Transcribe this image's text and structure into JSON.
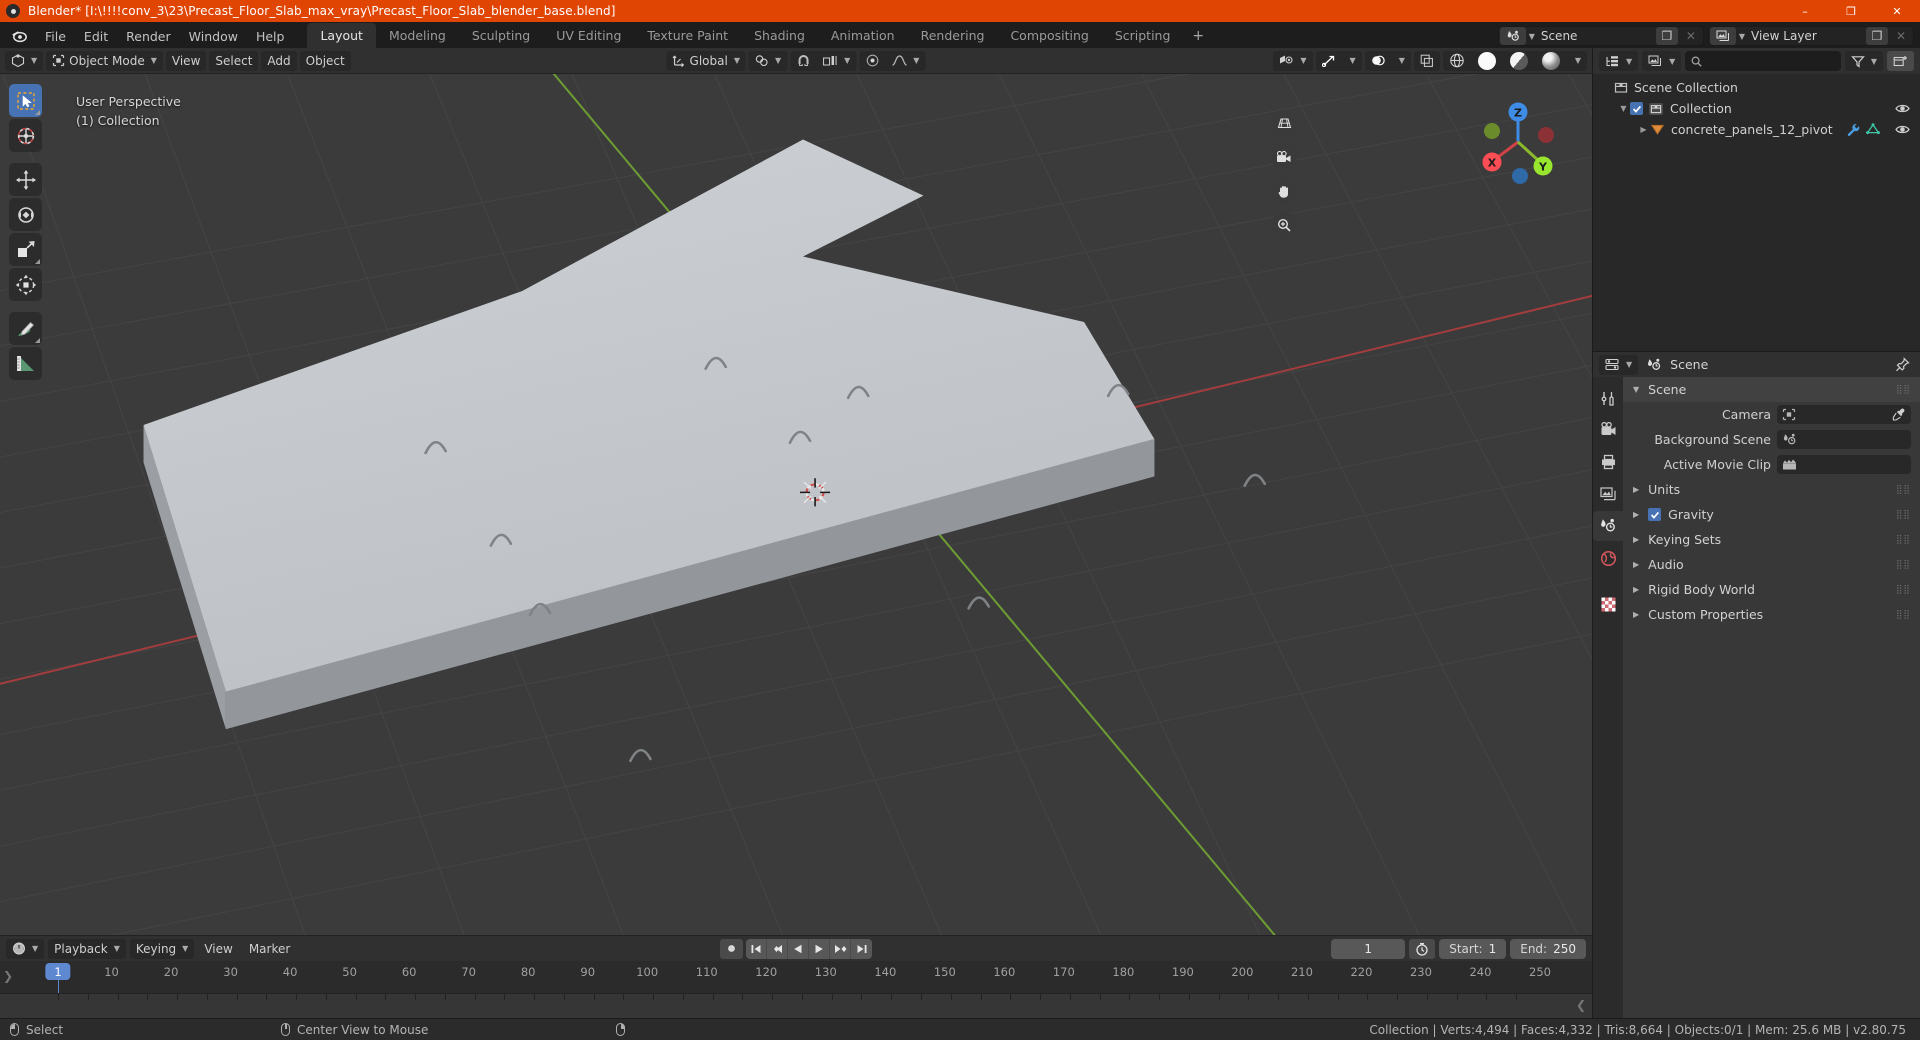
{
  "window": {
    "title": "Blender* [I:\\!!!!conv_3\\23\\Precast_Floor_Slab_max_vray\\Precast_Floor_Slab_blender_base.blend]",
    "app_icon": "blender-logo-icon",
    "minimize": "–",
    "maximize": "❐",
    "close": "✕",
    "title_bar_color": "#e04504"
  },
  "menubar": {
    "items": [
      "File",
      "Edit",
      "Render",
      "Window",
      "Help"
    ]
  },
  "workspace_tabs": {
    "tabs": [
      "Layout",
      "Modeling",
      "Sculpting",
      "UV Editing",
      "Texture Paint",
      "Shading",
      "Animation",
      "Rendering",
      "Compositing",
      "Scripting"
    ],
    "active": "Layout",
    "add_label": "+"
  },
  "topbar_right": {
    "scene_icon": "scene-icon",
    "scene_name": "Scene",
    "scene_new_label": "❐",
    "scene_unlink_label": "✕",
    "viewlayer_icon": "view-layer-icon",
    "viewlayer_name": "View Layer",
    "viewlayer_new_label": "❐",
    "viewlayer_remove_label": "✕"
  },
  "viewport_header": {
    "editor_type_icon": "editor-type-3dview-icon",
    "mode_icon": "object-mode-icon",
    "mode_label": "Object Mode",
    "menus": [
      "View",
      "Select",
      "Add",
      "Object"
    ],
    "transform_orientation_icon": "orientation-axis-icon",
    "transform_orientation": "Global",
    "snap_magnet_icon": "magnet-icon",
    "snap_target_icon": "snap-increment-icon",
    "pivot_icon": "pivot-median-icon",
    "proportional_icon": "proportional-falloff-icon",
    "visibility_icon": "object-types-visibility-icon",
    "gizmo_icon": "gizmo-icon",
    "overlays_icon": "overlays-icon",
    "xray_icon": "xray-toggle-icon",
    "shading_modes": [
      "wireframe",
      "solid",
      "material-preview",
      "rendered"
    ],
    "shading_active": "solid"
  },
  "viewport": {
    "perspective_label": "User Perspective",
    "collection_label": "(1) Collection",
    "background_color": "#3b3b3b",
    "object_color": "#c4c7cb",
    "object_side_color": "#8e9296",
    "grid_color": "#484848",
    "axis_x_color": "#cb4343",
    "axis_y_color": "#7db03e",
    "toolbar": [
      "select-box-tool",
      "cursor-tool",
      "move-tool",
      "rotate-tool",
      "scale-tool",
      "transform-tool",
      "annotate-tool",
      "measure-tool"
    ],
    "nav_icons": [
      "grid-ortho-toggle-icon",
      "camera-view-icon",
      "pan-hand-icon",
      "zoom-magnifier-icon"
    ],
    "gizmo_axes": [
      {
        "label": "X",
        "color": "#fc4d55"
      },
      {
        "label": "Y",
        "color": "#99e62e"
      },
      {
        "label": "Z",
        "color": "#3e8ce5"
      }
    ]
  },
  "outliner": {
    "display_mode_icon": "outliner-display-mode-icon",
    "filter_scene_icon": "scene-data-icon",
    "search_placeholder": "",
    "search_value": "",
    "search_icon": "search-icon",
    "filter_icon": "filter-funnel-icon",
    "new_collection_icon": "new-collection-icon",
    "rows": [
      {
        "name": "Scene Collection",
        "icon": "collection-icon",
        "indent": 0,
        "expand": "",
        "checkbox": false,
        "eye": false,
        "extra_icons": []
      },
      {
        "name": "Collection",
        "icon": "collection-icon",
        "indent": 1,
        "expand": "▼",
        "checkbox": true,
        "eye": true,
        "extra_icons": []
      },
      {
        "name": "concrete_panels_12_pivot",
        "icon": "mesh-object-icon",
        "indent": 2,
        "expand": "▶",
        "checkbox": false,
        "eye": true,
        "extra_icons": [
          "modifier-wrench-icon",
          "mesh-data-icon"
        ]
      }
    ]
  },
  "properties": {
    "editor_icon": "properties-editor-icon",
    "breadcrumb_icon": "scene-icon",
    "breadcrumb": "Scene",
    "pin_icon": "pin-icon",
    "tabs": [
      {
        "name": "tool",
        "icon": "tool-icon",
        "active": false
      },
      {
        "name": "render",
        "icon": "render-camera-icon",
        "active": false
      },
      {
        "name": "output",
        "icon": "output-printer-icon",
        "active": false
      },
      {
        "name": "view-layer",
        "icon": "view-layer-images-icon",
        "active": false
      },
      {
        "name": "scene",
        "icon": "scene-icon",
        "active": true
      },
      {
        "name": "world",
        "icon": "world-globe-icon",
        "active": false
      },
      {
        "name": "texture",
        "icon": "texture-checker-icon",
        "active": false
      }
    ],
    "panels": [
      {
        "label": "Scene",
        "expanded": true,
        "triangle": "▼"
      },
      {
        "label": "Units",
        "expanded": false,
        "triangle": "▶"
      },
      {
        "label": "Gravity",
        "expanded": false,
        "triangle": "▶",
        "checkbox": true
      },
      {
        "label": "Keying Sets",
        "expanded": false,
        "triangle": "▶"
      },
      {
        "label": "Audio",
        "expanded": false,
        "triangle": "▶"
      },
      {
        "label": "Rigid Body World",
        "expanded": false,
        "triangle": "▶"
      },
      {
        "label": "Custom Properties",
        "expanded": false,
        "triangle": "▶"
      }
    ],
    "scene_rows": [
      {
        "label": "Camera",
        "value": "",
        "icon": "camera-data-icon",
        "eyedropper": true
      },
      {
        "label": "Background Scene",
        "value": "",
        "icon": "scene-icon",
        "eyedropper": false
      },
      {
        "label": "Active Movie Clip",
        "value": "",
        "icon": "movie-clip-icon",
        "eyedropper": false
      }
    ]
  },
  "timeline": {
    "editor_icon": "timeline-editor-icon",
    "menus": [
      "Playback",
      "Keying",
      "View",
      "Marker"
    ],
    "record_icon": "record-icon",
    "transport": [
      "jump-to-start-icon",
      "jump-to-prev-keyframe-icon",
      "play-reverse-icon",
      "play-icon",
      "jump-to-next-keyframe-icon",
      "jump-to-end-icon"
    ],
    "current_frame": "1",
    "autokey_icon": "auto-keyframe-icon",
    "start_label": "Start:",
    "start_value": "1",
    "end_label": "End:",
    "end_value": "250",
    "ruler_ticks": [
      "1",
      "10",
      "20",
      "30",
      "40",
      "50",
      "60",
      "70",
      "80",
      "90",
      "100",
      "110",
      "120",
      "130",
      "140",
      "150",
      "160",
      "170",
      "180",
      "190",
      "200",
      "210",
      "220",
      "230",
      "240",
      "250"
    ],
    "playhead_frame": "1",
    "playhead_color": "#5e89d1"
  },
  "statusbar": {
    "keymap": [
      {
        "mouse": "left",
        "label": "Select"
      },
      {
        "mouse": "middle",
        "label": "Center View to Mouse"
      },
      {
        "mouse": "right",
        "label": ""
      }
    ],
    "stats": "Collection | Verts:4,494 | Faces:4,332 | Tris:8,664 | Objects:0/1 | Mem: 25.6 MB | v2.80.75"
  }
}
